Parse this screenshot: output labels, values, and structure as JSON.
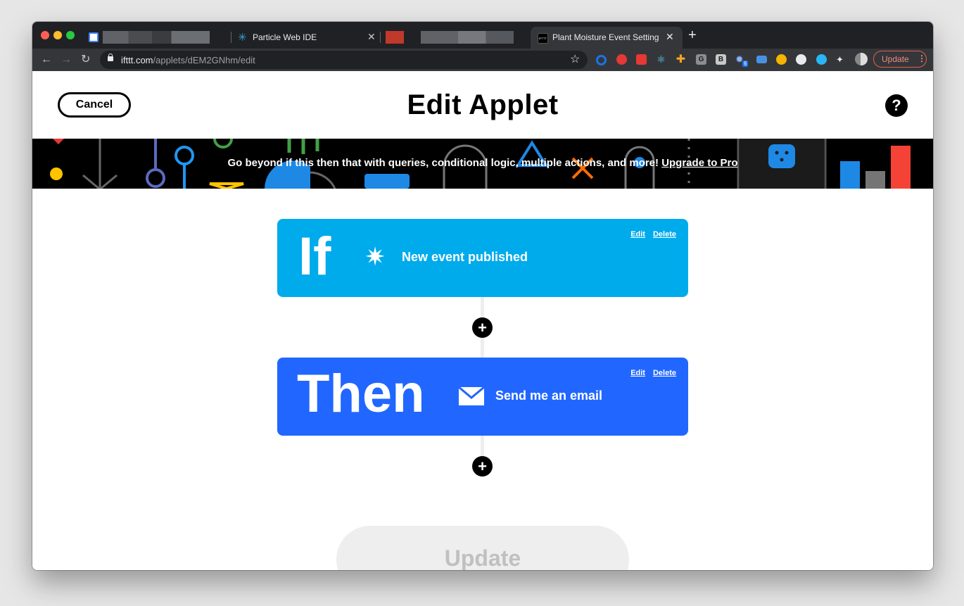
{
  "browser": {
    "tabs": [
      {
        "title": ""
      },
      {
        "title": "Particle Web IDE"
      },
      {
        "title": ""
      },
      {
        "title": "Plant Moisture Event Settings -"
      }
    ],
    "new_tab_symbol": "+",
    "url_host": "ifttt.com",
    "url_path": "/applets/dEM2GNhm/edit",
    "update_label": "Update",
    "extension_badge": "6",
    "ifttt_favicon_text": "IFTTT"
  },
  "header": {
    "cancel_label": "Cancel",
    "title": "Edit Applet",
    "help_symbol": "?"
  },
  "banner": {
    "text": "Go beyond if this then that with queries, conditional logic, multiple actions, and more!",
    "link_label": "Upgrade to Pro"
  },
  "trigger": {
    "keyword": "If",
    "label": "New event published",
    "icon": "particle-star-icon",
    "edit_label": "Edit",
    "delete_label": "Delete",
    "color": "#00abec"
  },
  "action": {
    "keyword": "Then",
    "label": "Send me an email",
    "icon": "envelope-icon",
    "edit_label": "Edit",
    "delete_label": "Delete",
    "color": "#2167ff"
  },
  "add_step_symbol": "+",
  "footer": {
    "update_label": "Update"
  }
}
